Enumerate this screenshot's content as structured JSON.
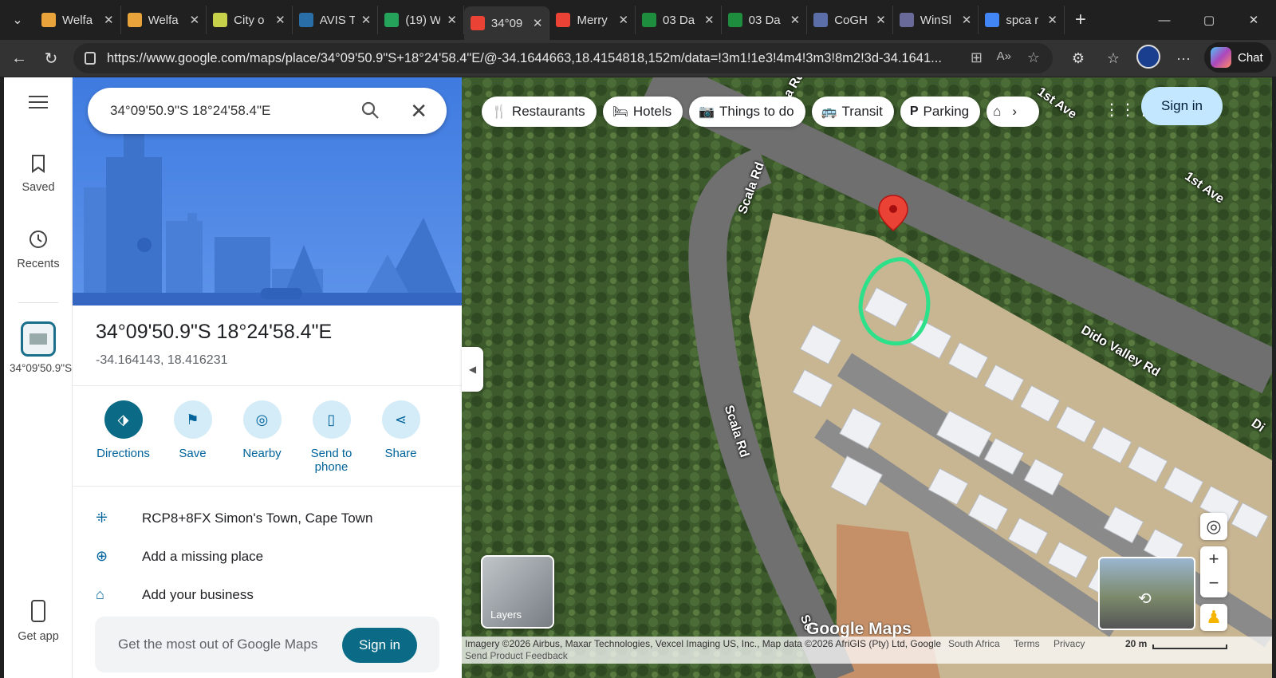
{
  "tabs": [
    {
      "title": "Welfa",
      "color": "#e8a33a"
    },
    {
      "title": "Welfa",
      "color": "#e8a33a"
    },
    {
      "title": "City o",
      "color": "#c8d14a"
    },
    {
      "title": "AVIS T",
      "color": "#2a6ea8"
    },
    {
      "title": "(19) W",
      "color": "#25a35a"
    },
    {
      "title": "34°09",
      "color": "#ea4335"
    },
    {
      "title": "Merry",
      "color": "#ea4335"
    },
    {
      "title": "03 Da",
      "color": "#1e8e3e"
    },
    {
      "title": "03 Da",
      "color": "#1e8e3e"
    },
    {
      "title": "CoGH",
      "color": "#5b6ea8"
    },
    {
      "title": "WinSl",
      "color": "#6a6a9a"
    },
    {
      "title": "spca r",
      "color": "#4285f4"
    }
  ],
  "url": "https://www.google.com/maps/place/34°09'50.9\"S+18°24'58.4\"E/@-34.1644663,18.4154818,152m/data=!3m1!1e3!4m4!3m3!8m2!3d-34.1641...",
  "chat_label": "Chat",
  "rail": {
    "saved": "Saved",
    "recents": "Recents",
    "recent_place": "34°09'50.9\"S...",
    "get_app": "Get app"
  },
  "search": {
    "value": "34°09'50.9\"S 18°24'58.4\"E"
  },
  "place": {
    "title": "34°09'50.9\"S 18°24'58.4\"E",
    "coords": "-34.164143, 18.416231"
  },
  "actions": [
    {
      "label": "Directions"
    },
    {
      "label": "Save"
    },
    {
      "label": "Nearby"
    },
    {
      "label": "Send to phone"
    },
    {
      "label": "Share"
    }
  ],
  "details": {
    "plus_code": "RCP8+8FX Simon's Town, Cape Town",
    "add_place": "Add a missing place",
    "add_business": "Add your business"
  },
  "promo": {
    "text": "Get the most out of Google Maps",
    "button": "Sign in"
  },
  "chips": [
    "Restaurants",
    "Hotels",
    "Things to do",
    "Transit",
    "Parking"
  ],
  "map": {
    "sign_in": "Sign in",
    "streets": {
      "scala1": "Scala Rd",
      "scala2": "Scala Rd",
      "scala3": "Sc",
      "dido": "Dido Valley Rd",
      "first1": "1st Ave",
      "first2": "1st Ave",
      "la": "a Rd",
      "di": "Di"
    },
    "layers": "Layers",
    "watermark": "Google Maps",
    "attribution": "Imagery ©2026 Airbus, Maxar Technologies, Vexcel Imaging US, Inc., Map data ©2026 AfriGIS (Pty) Ltd, Google",
    "south_africa": "South Africa",
    "terms": "Terms",
    "privacy": "Privacy",
    "feedback": "Send Product Feedback",
    "scale": "20 m"
  }
}
